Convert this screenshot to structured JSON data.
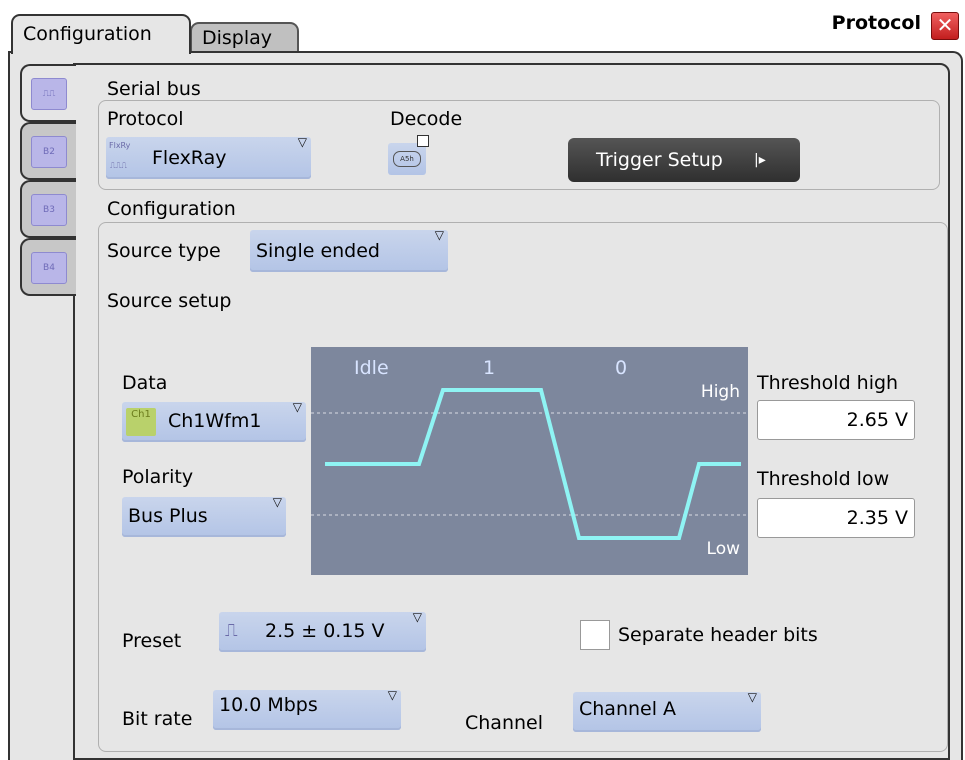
{
  "tabs": [
    {
      "label": "Configuration",
      "active": true
    },
    {
      "label": "Display",
      "active": false
    }
  ],
  "panel_title": "Protocol",
  "close_glyph": "✕",
  "side_tabs": [
    {
      "icon": "serial-bus-icon",
      "label": "",
      "active": true
    },
    {
      "icon": "serial-bus-icon",
      "label": "B2",
      "active": false
    },
    {
      "icon": "serial-bus-icon",
      "label": "B3",
      "active": false
    },
    {
      "icon": "serial-bus-icon",
      "label": "B4",
      "active": false
    }
  ],
  "serial_bus": {
    "section_label": "Serial bus",
    "protocol_label": "Protocol",
    "protocol_value": "FlexRay",
    "protocol_icon_text": "FlxRy",
    "decode_label": "Decode",
    "decode_icon_text": "A5h",
    "trigger_button": "Trigger Setup",
    "trigger_button_glyph": "|▸"
  },
  "configuration": {
    "section_label": "Configuration",
    "source_type_label": "Source type",
    "source_type_value": "Single ended",
    "source_setup_label": "Source setup",
    "data_label": "Data",
    "data_value": "Ch1Wfm1",
    "data_icon_text": "Ch1",
    "polarity_label": "Polarity",
    "polarity_value": "Bus Plus",
    "threshold_high_label": "Threshold high",
    "threshold_high_value": "2.65 V",
    "threshold_low_label": "Threshold low",
    "threshold_low_value": "2.35 V",
    "preset_label": "Preset",
    "preset_value": "2.5  ± 0.15 V",
    "separate_header_label": "Separate header bits",
    "separate_header_checked": false,
    "bit_rate_label": "Bit rate",
    "bit_rate_value": "10.0 Mbps",
    "channel_label": "Channel",
    "channel_value": "Channel A"
  },
  "waveform": {
    "labels": [
      "Idle",
      "1",
      "0"
    ],
    "high_label": "High",
    "low_label": "Low",
    "background": "#7d879d",
    "trace_color": "#8ff4f4"
  },
  "colors": {
    "dropdown": "#bccbe9",
    "panel": "#e6e6e6",
    "button_dark": "#3a3a3a",
    "close_red": "#d62b2b"
  }
}
